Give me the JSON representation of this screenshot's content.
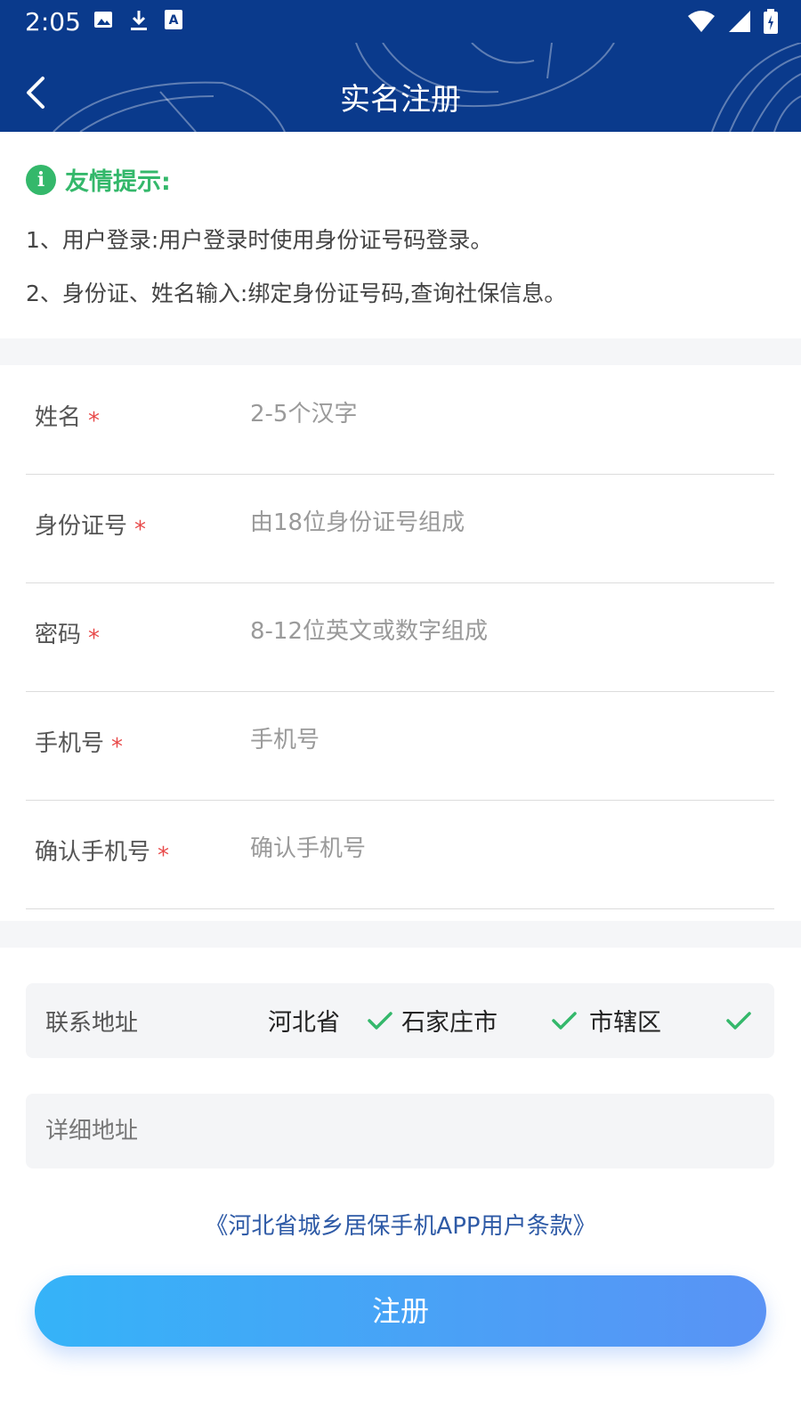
{
  "status_bar": {
    "time": "2:05"
  },
  "header": {
    "title": "实名注册"
  },
  "tips": {
    "title": "友情提示:",
    "lines": [
      "1、用户登录:用户登录时使用身份证号码登录。",
      "2、身份证、姓名输入:绑定身份证号码,查询社保信息。"
    ]
  },
  "form": {
    "fields": [
      {
        "label": "姓名",
        "required_mark": "*",
        "placeholder": "2-5个汉字"
      },
      {
        "label": "身份证号",
        "required_mark": "*",
        "placeholder": "由18位身份证号组成"
      },
      {
        "label": "密码",
        "required_mark": "*",
        "placeholder": "8-12位英文或数字组成"
      },
      {
        "label": "手机号",
        "required_mark": "*",
        "placeholder": "手机号"
      },
      {
        "label": "确认手机号",
        "required_mark": "*",
        "placeholder": "确认手机号"
      }
    ]
  },
  "address": {
    "label": "联系地址",
    "province": "河北省",
    "city": "石家庄市",
    "district": "市辖区"
  },
  "detail_address": {
    "placeholder": "详细地址"
  },
  "terms_link": "《河北省城乡居保手机APP用户条款》",
  "register_button": "注册",
  "colors": {
    "header_bg": "#0a3a8c",
    "tip_green": "#34b86b",
    "required_red": "#e84a4a",
    "button_gradient_start": "#35b3f8",
    "button_gradient_end": "#5a93f5",
    "terms_blue": "#2e5aa6"
  }
}
